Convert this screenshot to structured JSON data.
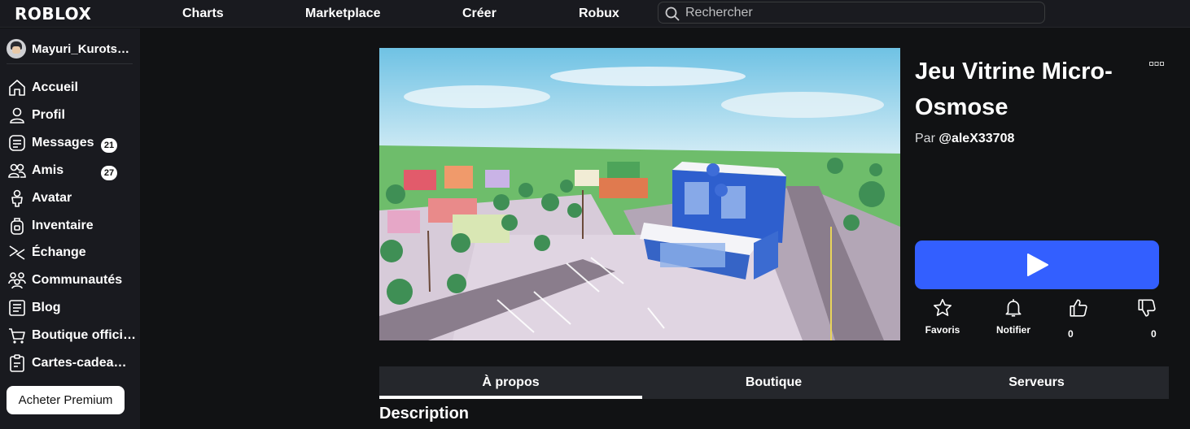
{
  "header": {
    "logo": "ROBLOX",
    "nav": [
      "Charts",
      "Marketplace",
      "Créer",
      "Robux"
    ],
    "search_placeholder": "Rechercher"
  },
  "sidebar": {
    "user": "Mayuri_Kurots…",
    "items": [
      {
        "label": "Accueil",
        "icon": "home-icon"
      },
      {
        "label": "Profil",
        "icon": "profile-icon"
      },
      {
        "label": "Messages",
        "icon": "messages-icon",
        "badge": "21"
      },
      {
        "label": "Amis",
        "icon": "friends-icon",
        "badge": "27"
      },
      {
        "label": "Avatar",
        "icon": "avatar-icon"
      },
      {
        "label": "Inventaire",
        "icon": "backpack-icon"
      },
      {
        "label": "Échange",
        "icon": "trade-icon"
      },
      {
        "label": "Communautés",
        "icon": "communities-icon"
      },
      {
        "label": "Blog",
        "icon": "blog-icon"
      },
      {
        "label": "Boutique offici…",
        "icon": "shop-icon"
      },
      {
        "label": "Cartes-cadea…",
        "icon": "gift-card-icon"
      }
    ],
    "premium_button": "Acheter Premium"
  },
  "game": {
    "title": "Jeu Vitrine Micro-Osmose",
    "creator_prefix": "Par",
    "creator": "@aleX33708",
    "actions": {
      "favorite": "Favoris",
      "notify": "Notifier",
      "upvotes": "0",
      "downvotes": "0"
    },
    "play_color": "#335fff"
  },
  "tabs": [
    "À propos",
    "Boutique",
    "Serveurs"
  ],
  "active_tab": "À propos",
  "section_title": "Description"
}
